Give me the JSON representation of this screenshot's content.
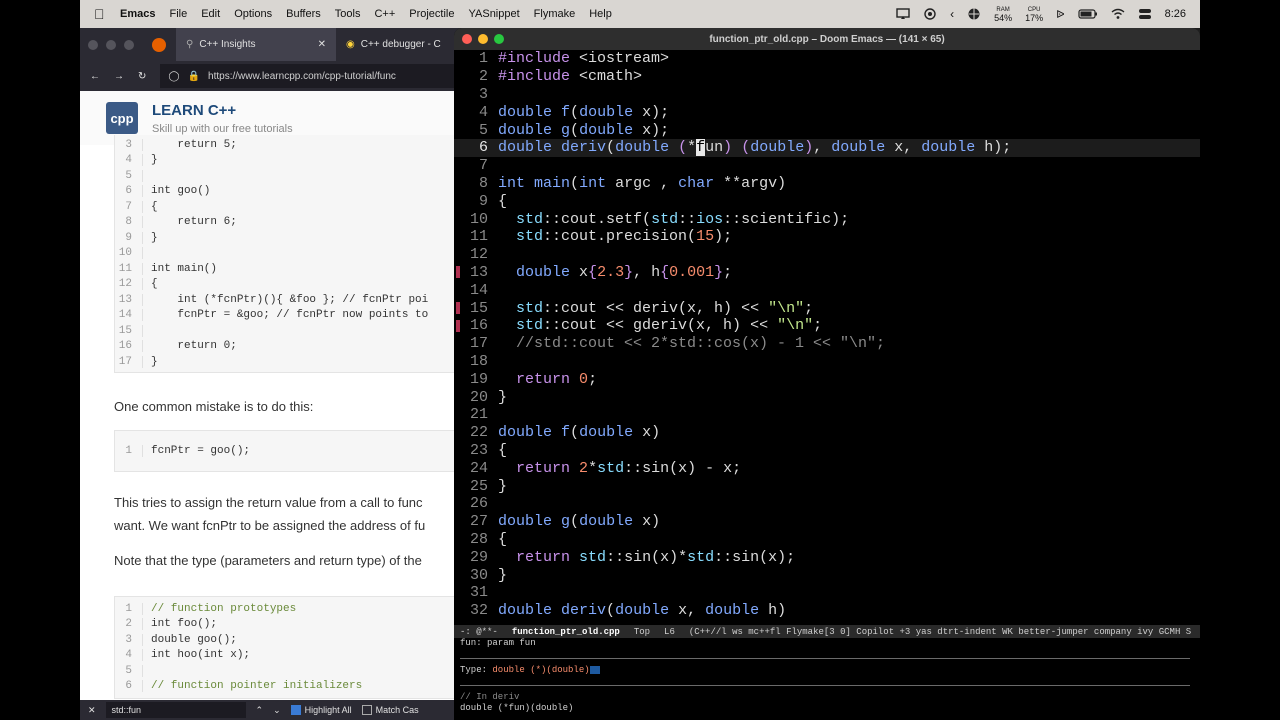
{
  "menubar": {
    "app": "Emacs",
    "items": [
      "File",
      "Edit",
      "Options",
      "Buffers",
      "Tools",
      "C++",
      "Projectile",
      "YASnippet",
      "Flymake",
      "Help"
    ],
    "ram_label": "RAM",
    "ram_value": "54%",
    "cpu_label": "CPU",
    "cpu_value": "17%",
    "time": "8:26"
  },
  "browser": {
    "tab1": "C++ Insights",
    "tab2": "C++ debugger - C",
    "url": "https://www.learncpp.com/cpp-tutorial/func",
    "site_title": "LEARN C++",
    "site_subtitle": "Skill up with our free tutorials",
    "logo": "cpp",
    "code1": [
      {
        "n": "3",
        "t": "    return 5;"
      },
      {
        "n": "4",
        "t": "}"
      },
      {
        "n": "5",
        "t": ""
      },
      {
        "n": "6",
        "t": "int goo()"
      },
      {
        "n": "7",
        "t": "{"
      },
      {
        "n": "8",
        "t": "    return 6;"
      },
      {
        "n": "9",
        "t": "}"
      },
      {
        "n": "10",
        "t": ""
      },
      {
        "n": "11",
        "t": "int main()"
      },
      {
        "n": "12",
        "t": "{"
      },
      {
        "n": "13",
        "t": "    int (*fcnPtr)(){ &foo }; // fcnPtr poi"
      },
      {
        "n": "14",
        "t": "    fcnPtr = &goo; // fcnPtr now points to"
      },
      {
        "n": "15",
        "t": ""
      },
      {
        "n": "16",
        "t": "    return 0;"
      },
      {
        "n": "17",
        "t": "}"
      }
    ],
    "prose1": "One common mistake is to do this:",
    "code2": [
      {
        "n": "1",
        "t": "fcnPtr = goo();"
      }
    ],
    "prose2a": "This tries to assign the return value from a call to func",
    "prose2b": "want. We want fcnPtr to be assigned the address of fu",
    "prose3": "Note that the type (parameters and return type) of the",
    "code3": [
      {
        "n": "1",
        "t": "// function prototypes"
      },
      {
        "n": "2",
        "t": "int foo();"
      },
      {
        "n": "3",
        "t": "double goo();"
      },
      {
        "n": "4",
        "t": "int hoo(int x);"
      },
      {
        "n": "5",
        "t": ""
      },
      {
        "n": "6",
        "t": "// function pointer initializers"
      }
    ],
    "find_query": "std::fun",
    "highlight_all": "Highlight All",
    "match_case": "Match Cas"
  },
  "emacs": {
    "title": "function_ptr_old.cpp – Doom Emacs — (141 × 65)",
    "modeline": {
      "state": "-:   @**-",
      "file": "function_ptr_old.cpp",
      "pos": "Top",
      "line": "L6",
      "modes": "(C++//l ws mc++fl Flymake[3 0] Copilot +3 yas dtrt-indent WK better-jumper company ivy GCMH S"
    },
    "echo1": "fun: param fun",
    "echo2_label": "Type: ",
    "echo2_value": "double (*)(double)",
    "echo3": "// In deriv",
    "echo4": "double (*fun)(double)"
  },
  "colors": {
    "accent": "#82aaff",
    "keyword": "#c792ea",
    "string": "#c3e88d",
    "number": "#f78c6c"
  }
}
